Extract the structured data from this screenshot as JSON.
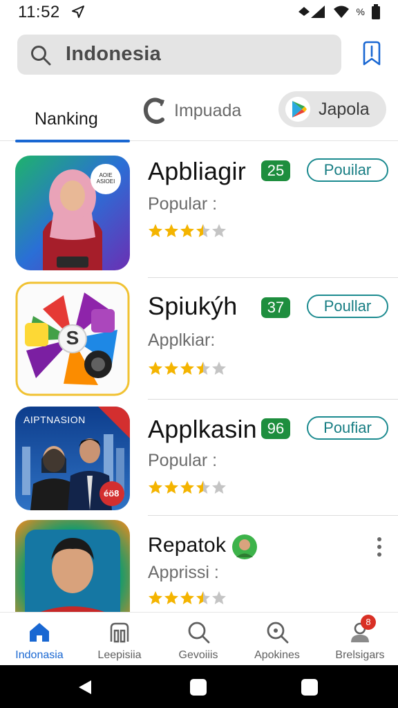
{
  "status_bar": {
    "time": "11:52",
    "icons": [
      "navigation-arrow-icon",
      "signal-icon",
      "wifi-icon",
      "battery-icon"
    ],
    "wifi_label": "%"
  },
  "search": {
    "value": "Indonesia",
    "icon": "search-icon"
  },
  "header": {
    "bookmark_icon": "bookmark-icon"
  },
  "tabs": [
    {
      "label": "Nanking",
      "active": true
    },
    {
      "label": "Impuada",
      "icon": "refresh-c-icon"
    },
    {
      "label": "Japola",
      "icon": "play-store-icon"
    }
  ],
  "apps": [
    {
      "name": "Apbliagir",
      "rank": "25",
      "tag": "Pouilar",
      "sub": "Popular :",
      "rating": 3.5,
      "thumb_text": "AOIE ASIOEI"
    },
    {
      "name": "Spiukýh",
      "rank": "37",
      "tag": "Poullar",
      "sub": "Applkiar:",
      "rating": 3.5,
      "thumb_text": "S"
    },
    {
      "name": "Applkasin",
      "rank": "96",
      "tag": "Poufiar",
      "sub": "Popular :",
      "rating": 3.5,
      "thumb_text": "AIPTNASION",
      "thumb_badge": "éö8"
    },
    {
      "name": "Repatok",
      "sub": "Apprissi :",
      "rating": 3.5
    }
  ],
  "bottom_nav": [
    {
      "label": "Indonasia",
      "icon": "home-icon",
      "active": true
    },
    {
      "label": "Leepisiia",
      "icon": "apps-icon"
    },
    {
      "label": "Gevoiiis",
      "icon": "search-icon"
    },
    {
      "label": "Apokines",
      "icon": "search-alt-icon"
    },
    {
      "label": "Brelsigars",
      "icon": "account-icon",
      "badge": "8"
    }
  ],
  "colors": {
    "accent": "#1967d2",
    "rank_green": "#1e8e3e",
    "tag_teal": "#177d83",
    "star": "#f4b400"
  }
}
